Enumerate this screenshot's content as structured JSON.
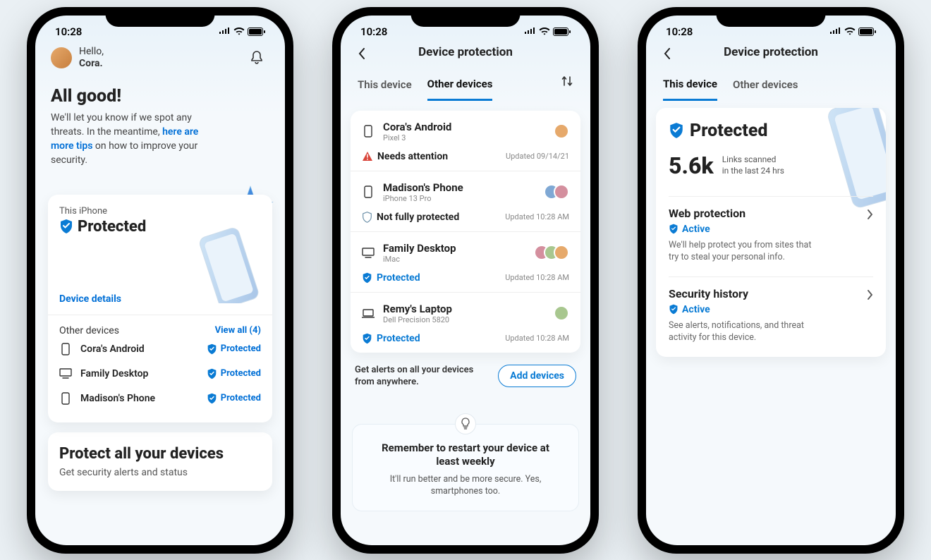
{
  "status_time": "10:28",
  "screen1": {
    "greeting_hello": "Hello,",
    "greeting_name": "Cora.",
    "headline": "All good!",
    "subtext_pre": "We'll let you know if we spot any threats. In the meantime, ",
    "subtext_link": "here are more tips",
    "subtext_post": " on how to improve your security.",
    "card_label": "This iPhone",
    "card_title": "Protected",
    "device_details": "Device details",
    "other_devices_label": "Other devices",
    "view_all": "View all (4)",
    "devices": [
      {
        "name": "Cora's Android",
        "type": "phone",
        "status": "Protected"
      },
      {
        "name": "Family Desktop",
        "type": "desktop",
        "status": "Protected"
      },
      {
        "name": "Madison's Phone",
        "type": "phone",
        "status": "Protected"
      }
    ],
    "promo_title": "Protect all your devices",
    "promo_sub": "Get security alerts and status"
  },
  "screen2": {
    "title": "Device protection",
    "tab_this": "This device",
    "tab_other": "Other devices",
    "devices": [
      {
        "name": "Cora's Android",
        "model": "Pixel 3",
        "type": "phone",
        "status": "Needs attention",
        "status_kind": "need",
        "updated": "Updated 09/14/21",
        "avatars": 1
      },
      {
        "name": "Madison's Phone",
        "model": "iPhone 13 Pro",
        "type": "phone",
        "status": "Not fully protected",
        "status_kind": "nfp",
        "updated": "Updated 10:28 AM",
        "avatars": 2
      },
      {
        "name": "Family Desktop",
        "model": "iMac",
        "type": "desktop",
        "status": "Protected",
        "status_kind": "prot",
        "updated": "Updated 10:28 AM",
        "avatars": 3
      },
      {
        "name": "Remy's Laptop",
        "model": "Dell Precision 5820",
        "type": "laptop",
        "status": "Protected",
        "status_kind": "prot",
        "updated": "Updated 10:28 AM",
        "avatars": 1
      }
    ],
    "alert_text": "Get alerts on all your devices from anywhere.",
    "add_btn": "Add devices",
    "tip_title": "Remember to restart your device at least weekly",
    "tip_sub": "It'll run better and be more secure. Yes, smartphones too."
  },
  "screen3": {
    "title": "Device protection",
    "tab_this": "This device",
    "tab_other": "Other devices",
    "protected": "Protected",
    "stat_num": "5.6k",
    "stat_desc1": "Links scanned",
    "stat_desc2": "in the last 24 hrs",
    "web_title": "Web protection",
    "active": "Active",
    "web_desc": "We'll help protect you from sites that try to steal your personal info.",
    "history_title": "Security history",
    "history_desc": "See alerts, notifications, and threat activity for this device."
  }
}
